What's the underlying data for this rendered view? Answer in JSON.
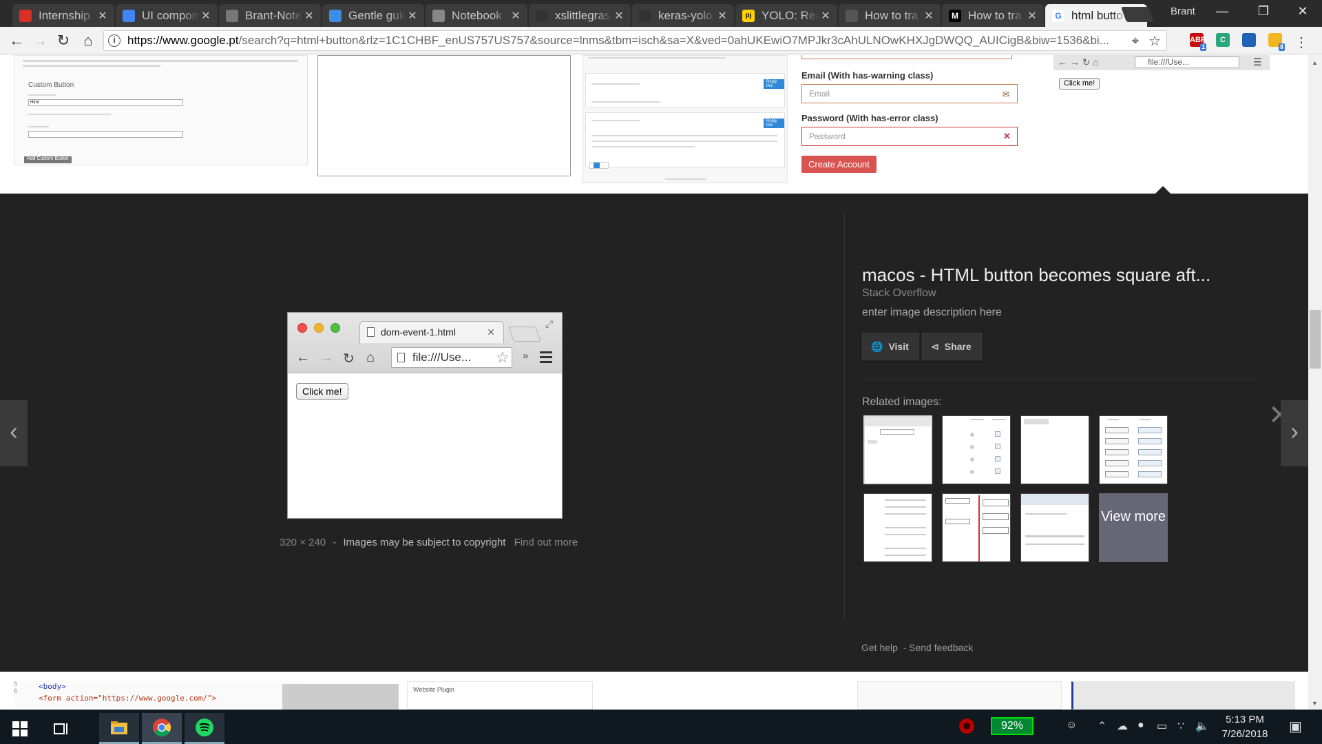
{
  "browser": {
    "tabs": [
      {
        "label": "Internship",
        "icon": "gmail-icon",
        "color": "#d93025"
      },
      {
        "label": "UI compon",
        "icon": "docs-icon",
        "color": "#4285f4"
      },
      {
        "label": "Brant-Note",
        "icon": "notebook-icon",
        "color": "#777777"
      },
      {
        "label": "Gentle guid",
        "icon": "paint-icon",
        "color": "#3a8ee6"
      },
      {
        "label": "Notebook",
        "icon": "page-icon",
        "color": "#888888"
      },
      {
        "label": "xslittlegras",
        "icon": "github-icon",
        "color": "#333333"
      },
      {
        "label": "keras-yolo",
        "icon": "github-icon",
        "color": "#333333"
      },
      {
        "label": "YOLO: Real",
        "icon": "pj-icon",
        "color": "#ffd400"
      },
      {
        "label": "How to tra",
        "icon": "blank-icon",
        "color": "#555555"
      },
      {
        "label": "How to tra",
        "icon": "medium-icon",
        "color": "#000000"
      },
      {
        "label": "html butto",
        "icon": "google-icon",
        "color": "#ffffff"
      }
    ],
    "profile_name": "Brant",
    "url_host": "https://www.google.pt",
    "url_path": "/search?q=html+button&rlz=1C1CHBF_enUS757US757&source=lnms&tbm=isch&sa=X&ved=0ahUKEwiO7MPJkr3cAhULNOwKHXJgDWQQ_AUICigB&biw=1536&bi...",
    "extensions": [
      {
        "label": "ABP",
        "color": "#c70d0d",
        "badge": "1"
      },
      {
        "label": "C",
        "color": "#2aa67a",
        "badge": ""
      },
      {
        "label": "",
        "color": "#1e63b8",
        "badge": ""
      },
      {
        "label": "",
        "color": "#f2b620",
        "badge": "8"
      }
    ]
  },
  "top_results": {
    "custom_button_title": "Custom Button",
    "custom_button_field_value": "Html",
    "add_custom_button": "Add Custom Button",
    "email_label": "Email (With has-warning class)",
    "email_placeholder": "Email",
    "password_label": "Password (With has-error class)",
    "password_placeholder": "Password",
    "create_account": "Create Account",
    "reply_label": "Reply this",
    "side_click_me": "Click me!",
    "side_url": "file:///Use..."
  },
  "preview": {
    "tab_title": "dom-event-1.html",
    "omnibox_text": "file:///Use...",
    "button_label": "Click me!",
    "dimensions": "320 × 240",
    "separator": "-",
    "copyright": "Images may be subject to copyright",
    "find_out_more": "Find out more"
  },
  "details": {
    "title": "macos - HTML button becomes square aft...",
    "source": "Stack Overflow",
    "description": "enter image description here",
    "visit_label": "Visit",
    "share_label": "Share",
    "related_label": "Related images:",
    "view_more": "View more",
    "get_help": "Get help",
    "separator": "-",
    "send_feedback": "Send feedback"
  },
  "bottom_results": {
    "code_line1": "<body>",
    "code_line2": "<form action=\"https://www.google.com/\">",
    "website_plugin": "Website Plugin"
  },
  "taskbar": {
    "battery_percent": "92%",
    "time": "5:13 PM",
    "date": "7/26/2018"
  }
}
